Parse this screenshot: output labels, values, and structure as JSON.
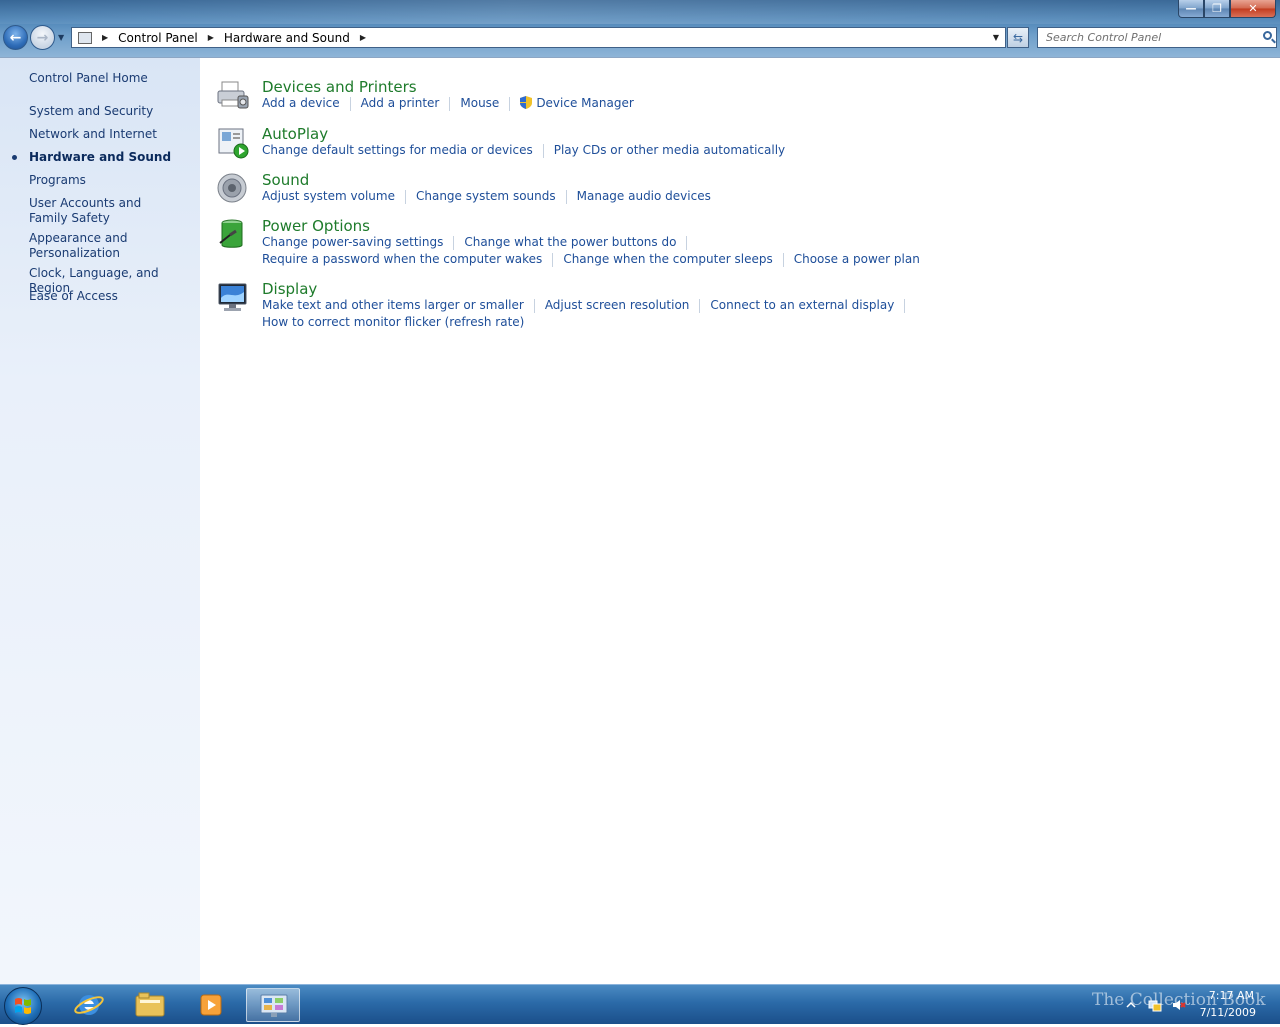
{
  "window": {
    "minimize_label": "—",
    "maximize_label": "❐",
    "close_label": "✕"
  },
  "address": {
    "crumbs": [
      "Control Panel",
      "Hardware and Sound"
    ],
    "search_placeholder": "Search Control Panel"
  },
  "sidebar": {
    "home": "Control Panel Home",
    "items": [
      {
        "label": "System and Security"
      },
      {
        "label": "Network and Internet"
      },
      {
        "label": "Hardware and Sound",
        "current": true
      },
      {
        "label": "Programs"
      },
      {
        "label": "User Accounts and Family Safety"
      },
      {
        "label": "Appearance and Personalization"
      },
      {
        "label": "Clock, Language, and Region"
      },
      {
        "label": "Ease of Access"
      }
    ]
  },
  "categories": [
    {
      "title": "Devices and Printers",
      "icon": "printer-icon",
      "links": [
        "Add a device",
        "Add a printer",
        "Mouse",
        "Device Manager"
      ]
    },
    {
      "title": "AutoPlay",
      "icon": "autoplay-icon",
      "links": [
        "Change default settings for media or devices",
        "Play CDs or other media automatically"
      ]
    },
    {
      "title": "Sound",
      "icon": "speaker-icon",
      "links": [
        "Adjust system volume",
        "Change system sounds",
        "Manage audio devices"
      ]
    },
    {
      "title": "Power Options",
      "icon": "battery-icon",
      "links": [
        "Change power-saving settings",
        "Change what the power buttons do",
        "Require a password when the computer wakes",
        "Change when the computer sleeps",
        "Choose a power plan"
      ]
    },
    {
      "title": "Display",
      "icon": "monitor-icon",
      "links": [
        "Make text and other items larger or smaller",
        "Adjust screen resolution",
        "Connect to an external display",
        "How to correct monitor flicker (refresh rate)"
      ]
    }
  ],
  "taskbar": {
    "clock_time": "7:17 AM",
    "clock_date": "7/11/2009",
    "watermark": "The Collection Book",
    "pinned": [
      "internet-explorer-icon",
      "windows-explorer-icon",
      "media-player-icon",
      "control-panel-icon"
    ]
  }
}
